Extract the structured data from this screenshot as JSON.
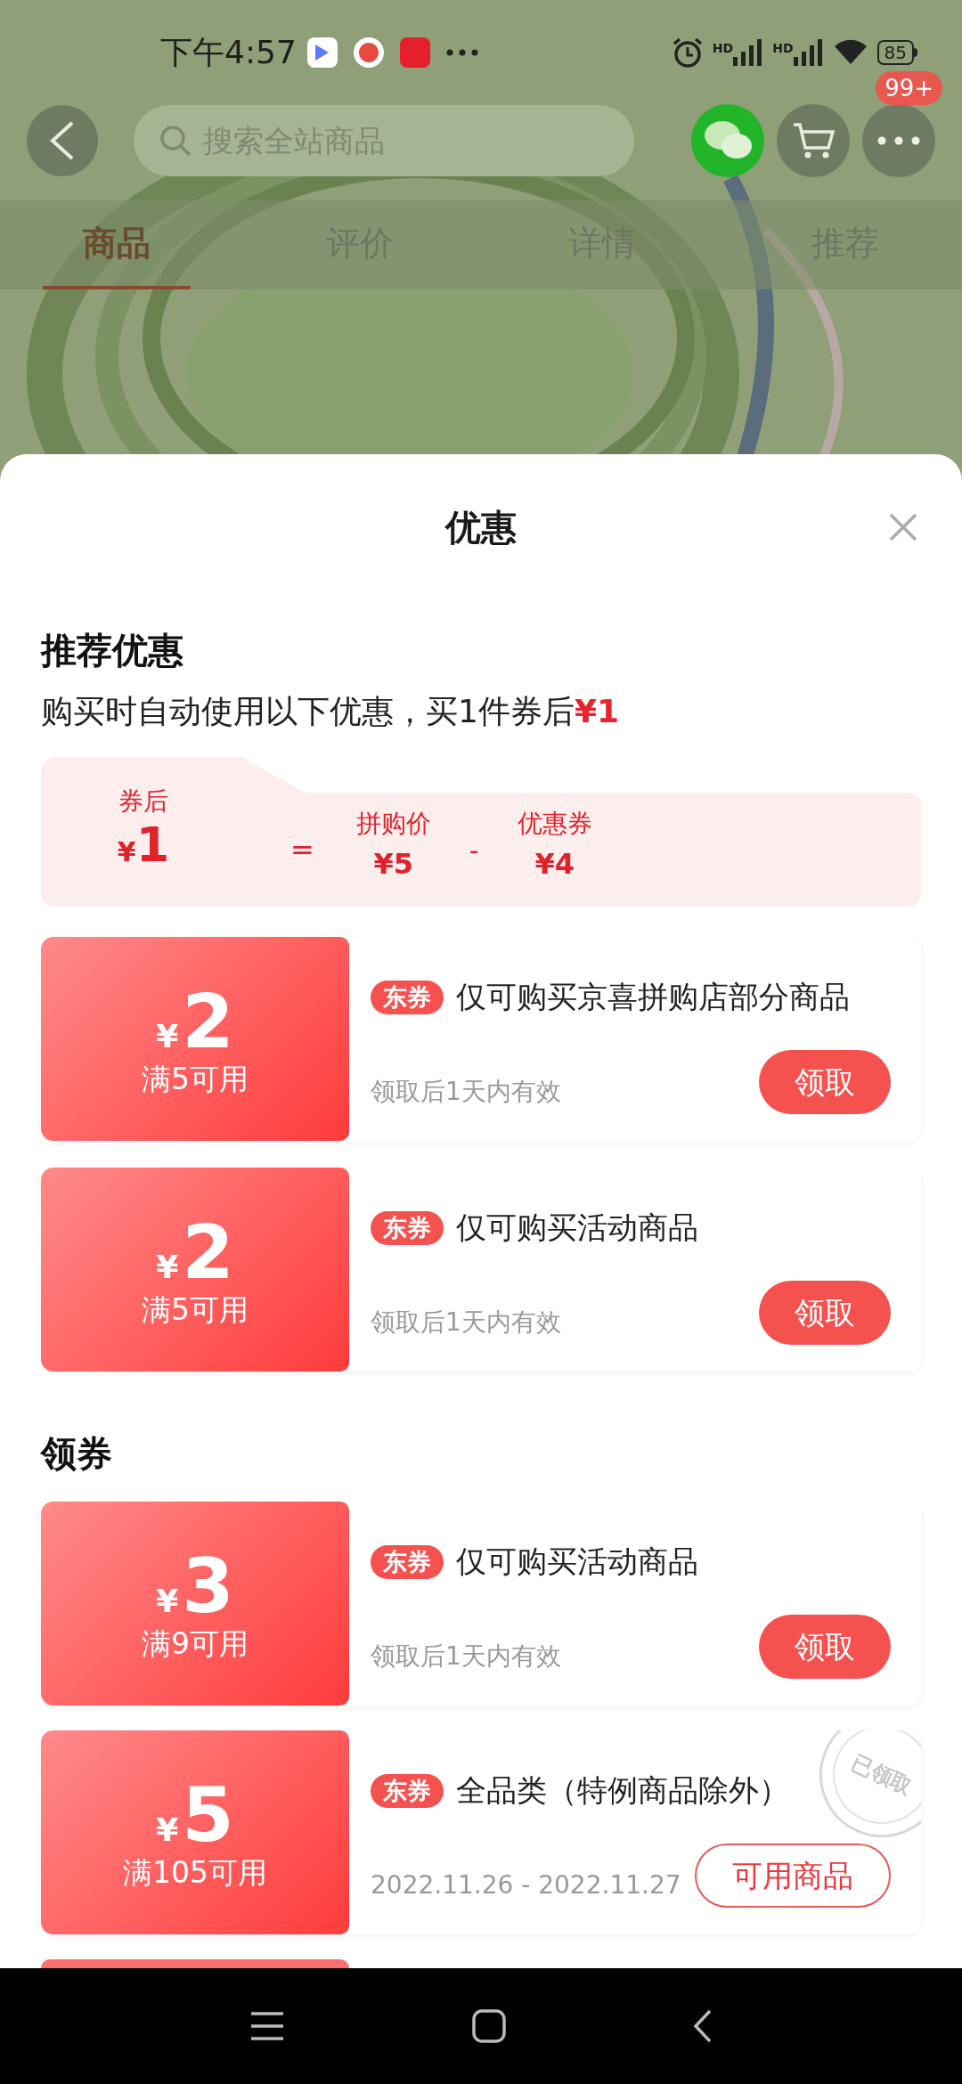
{
  "status_bar": {
    "time": "下午4:57",
    "signal_labels": [
      "HD",
      "HD"
    ],
    "battery": "85"
  },
  "header": {
    "search": {
      "placeholder": "搜索全站商品"
    },
    "badge": "99+"
  },
  "tabs": [
    {
      "label": "商品",
      "selected": true
    },
    {
      "label": "评价",
      "selected": false
    },
    {
      "label": "详情",
      "selected": false
    },
    {
      "label": "推荐",
      "selected": false
    }
  ],
  "sheet": {
    "title": "优惠",
    "recommended": {
      "heading": "推荐优惠",
      "summary": "购买时自动使用以下优惠，买1件券后",
      "summary_price": "¥1",
      "calc": {
        "result_label": "券后",
        "result_currency": "¥",
        "result_value": "1",
        "equals": "=",
        "minus": "-",
        "terms": [
          {
            "label": "拼购价",
            "value": "¥5"
          },
          {
            "label": "优惠券",
            "value": "¥4"
          }
        ]
      },
      "coupons": [
        {
          "currency": "¥",
          "amount": "2",
          "condition": "满5可用",
          "tag": "东券",
          "description": "仅可购买京喜拼购店部分商品",
          "validity": "领取后1天内有效",
          "button": {
            "label": "领取",
            "kind": "claim"
          }
        },
        {
          "currency": "¥",
          "amount": "2",
          "condition": "满5可用",
          "tag": "东券",
          "description": "仅可购买活动商品",
          "validity": "领取后1天内有效",
          "button": {
            "label": "领取",
            "kind": "claim"
          }
        }
      ]
    },
    "claim": {
      "heading": "领券",
      "coupons": [
        {
          "currency": "¥",
          "amount": "3",
          "condition": "满9可用",
          "tag": "东券",
          "description": "仅可购买活动商品",
          "validity": "领取后1天内有效",
          "button": {
            "label": "领取",
            "kind": "claim"
          }
        },
        {
          "currency": "¥",
          "amount": "5",
          "condition": "满105可用",
          "tag": "东券",
          "description": "全品类（特例商品除外）",
          "validity": "2022.11.26 - 2022.11.27",
          "button": {
            "label": "可用商品",
            "kind": "view"
          },
          "stamp": "已领取"
        }
      ]
    }
  }
}
